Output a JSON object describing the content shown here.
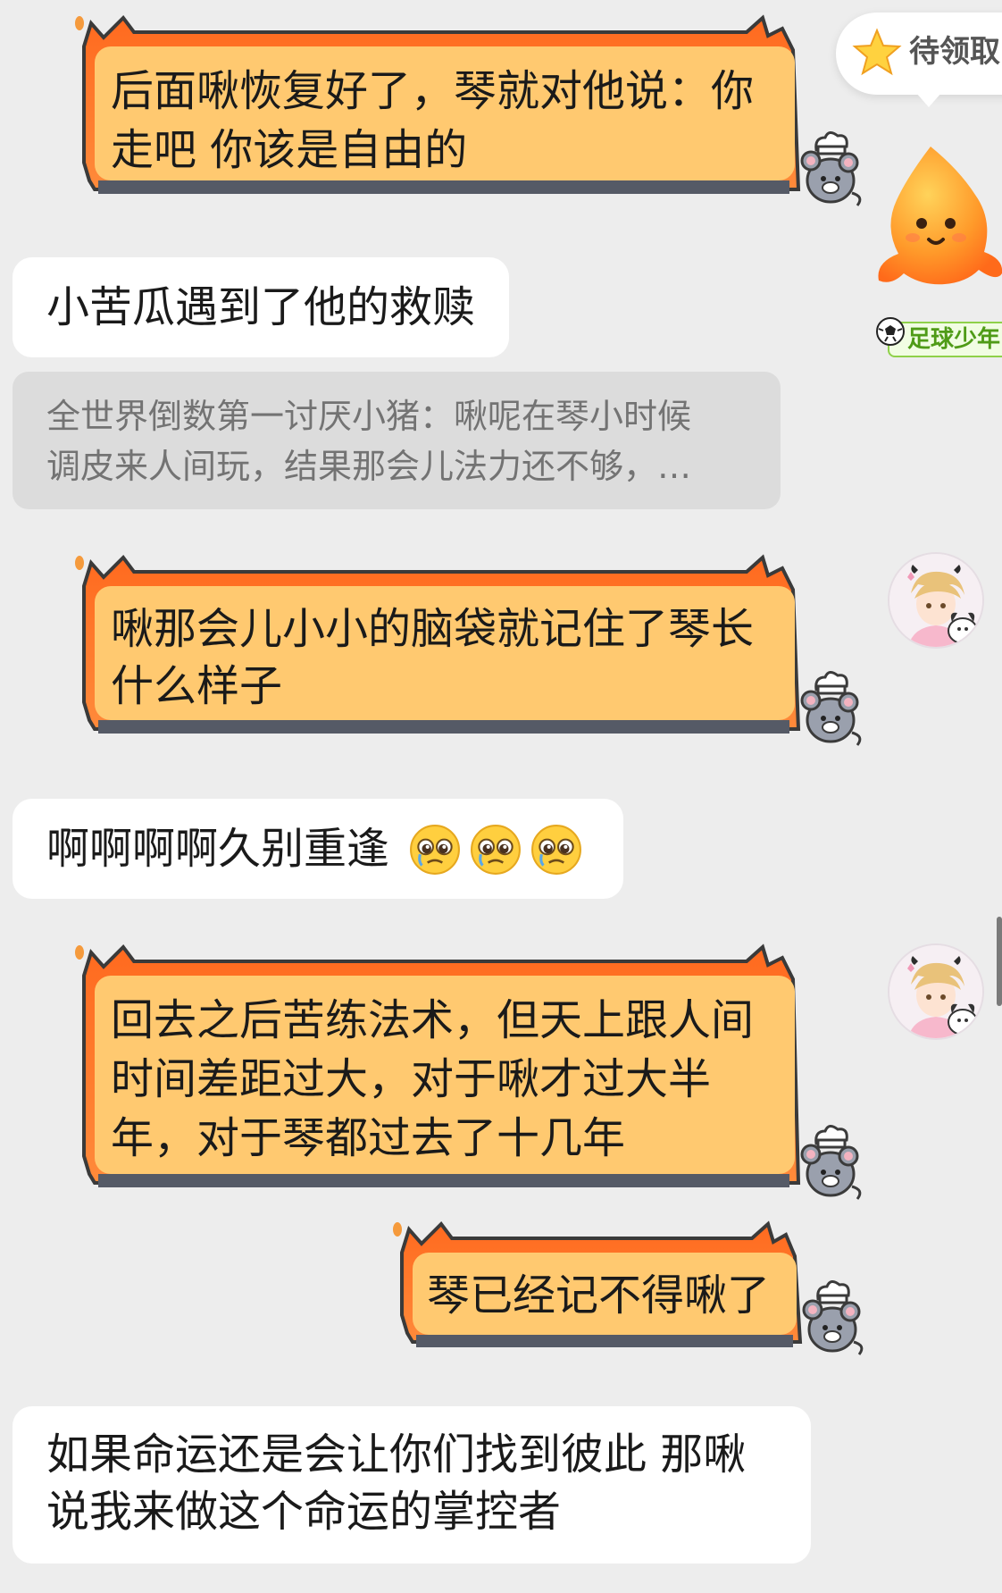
{
  "messages": {
    "m1": {
      "lines": [
        "后面啾恢复好了，琴就对他说：你",
        "走吧 你该是自由的"
      ]
    },
    "m2": {
      "text": "小苦瓜遇到了他的救赎"
    },
    "quote": {
      "lines": [
        "全世界倒数第一讨厌小猪：啾呢在琴小时候",
        "调皮来人间玩，结果那会儿法力还不够，…"
      ]
    },
    "m3": {
      "lines": [
        "啾那会儿小小的脑袋就记住了琴长",
        "什么样子"
      ]
    },
    "m4": {
      "text": "啊啊啊啊久别重逢",
      "emoji_count": 3
    },
    "m5": {
      "lines": [
        "回去之后苦练法术，但天上跟人间",
        "时间差距过大，对于啾才过大半",
        "年，对于琴都过去了十几年"
      ]
    },
    "m6": {
      "lines": [
        "琴已经记不得啾了"
      ]
    },
    "m7": {
      "lines": [
        "如果命运还是会让你们找到彼此 那啾",
        "说我来做这个命运的掌控者"
      ]
    }
  },
  "widgets": {
    "reward_label": "待领取",
    "badge_label": "足球少年"
  },
  "icons": {
    "star": "star-icon",
    "emoji": "pleading-face-emoji",
    "ball": "soccer-ball-icon",
    "mouse": "chef-mouse-sticker",
    "mascot": "orange-mascot"
  },
  "colors": {
    "background": "#ededed",
    "flame_fill": "#ffc970",
    "flame_outer": "#ff7a2c",
    "flame_border": "#3a3a3a",
    "badge_green": "#4f9b17"
  }
}
